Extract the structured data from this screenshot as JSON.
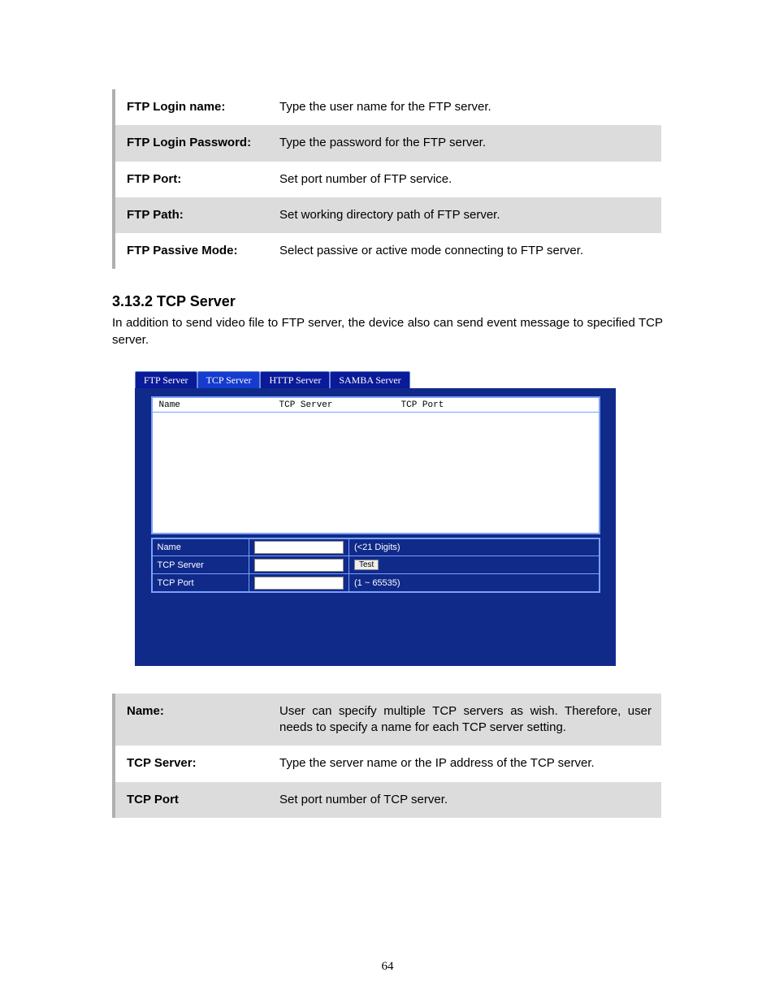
{
  "ftp_table": {
    "rows": [
      {
        "label": "FTP Login name:",
        "desc": "Type the user name for the FTP server.",
        "shade": false
      },
      {
        "label": "FTP Login Password:",
        "desc": "Type the password for the FTP server.",
        "shade": true
      },
      {
        "label": "FTP Port:",
        "desc": "Set port number of FTP service.",
        "shade": false
      },
      {
        "label": "FTP Path:",
        "desc": "Set working directory path of FTP server.",
        "shade": true
      },
      {
        "label": "FTP Passive Mode:",
        "desc": "Select passive or active mode connecting to FTP server.",
        "shade": false
      }
    ]
  },
  "section": {
    "heading": "3.13.2 TCP Server",
    "paragraph": "In addition to send video file to FTP server, the device also can send event message to specified TCP server."
  },
  "panel": {
    "tabs": {
      "ftp": "FTP Server",
      "tcp": "TCP Server",
      "http": "HTTP Server",
      "samba": "SAMBA Server"
    },
    "list_headers": {
      "name": "Name",
      "server": "TCP Server",
      "port": "TCP Port"
    },
    "form": {
      "name_label": "Name",
      "name_hint": "(<21 Digits)",
      "server_label": "TCP Server",
      "test_button": "Test",
      "port_label": "TCP Port",
      "port_hint": "(1 ~ 65535)"
    },
    "values": {
      "name": "",
      "server": "",
      "port": ""
    }
  },
  "tcp_table": {
    "rows": [
      {
        "label": "Name:",
        "desc": "User can specify multiple TCP servers as wish. Therefore, user needs to specify a name for each TCP server setting.",
        "shade": true,
        "just": true
      },
      {
        "label": "TCP Server:",
        "desc": "Type the server name or the IP address of the TCP server.",
        "shade": false,
        "just": false
      },
      {
        "label": "TCP Port",
        "desc": "Set port number of TCP server.",
        "shade": true,
        "just": false
      }
    ]
  },
  "page_number": "64"
}
